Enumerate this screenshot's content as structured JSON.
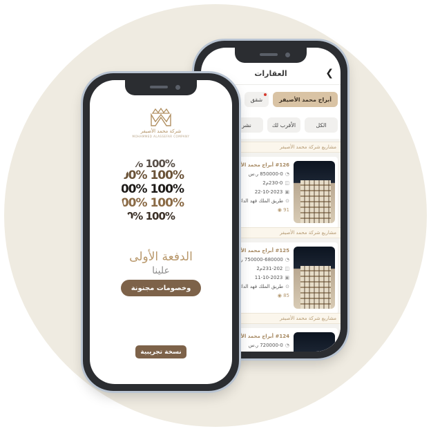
{
  "colors": {
    "background_circle": "#efebe1",
    "accent_brown": "#7d6249",
    "accent_gold": "#b8976a",
    "chip_active": "#d9c3a4"
  },
  "listing_screen": {
    "title": "العقارات",
    "back_icon": "chevron-left-icon",
    "filter_chips": [
      {
        "label": "أبراج محمد الأصيفر",
        "active": true
      },
      {
        "label": "شقق",
        "active": false,
        "badge": true
      },
      {
        "label": "أد",
        "active": false
      }
    ],
    "sort_chips": [
      {
        "label": "الكل"
      },
      {
        "label": "الأقرب لك"
      },
      {
        "label": "نشر"
      }
    ],
    "cards": [
      {
        "header": "مشاريع شركة محمد الأصيفر",
        "title": "#126 أبراج محمد الأصيفر",
        "price": "850000-0 ر.س",
        "area": "230-0م2",
        "date": "22-10-2023",
        "address": "طريق الملك فهد الدائر السعودية",
        "views": "91"
      },
      {
        "header": "مشاريع شركة محمد الأصيفر",
        "title": "#125 أبراج محمد الأصيفر",
        "price": "750000-680000 ر.س",
        "area": "231-202م2",
        "date": "11-10-2023",
        "address": "طريق الملك فهد الدائر السعودية",
        "views": "85"
      },
      {
        "header": "مشاريع شركة محمد الأصيفر",
        "title": "#124 أبراج محمد الأصيفر",
        "price": "720000-0 ر.س",
        "area": "",
        "date": "",
        "address": "",
        "views": ""
      }
    ]
  },
  "promo_screen": {
    "company_name": "شركة محمد الأصيفر",
    "company_name_en": "MOHAMMED ALASSEFAR COMPANY",
    "hundred_text": "100%",
    "headline": "الدفعة الأولى",
    "subline": "علينا",
    "discount_button": "وخصومات مجنونة",
    "trial_button": "نسخة تجريبية"
  }
}
